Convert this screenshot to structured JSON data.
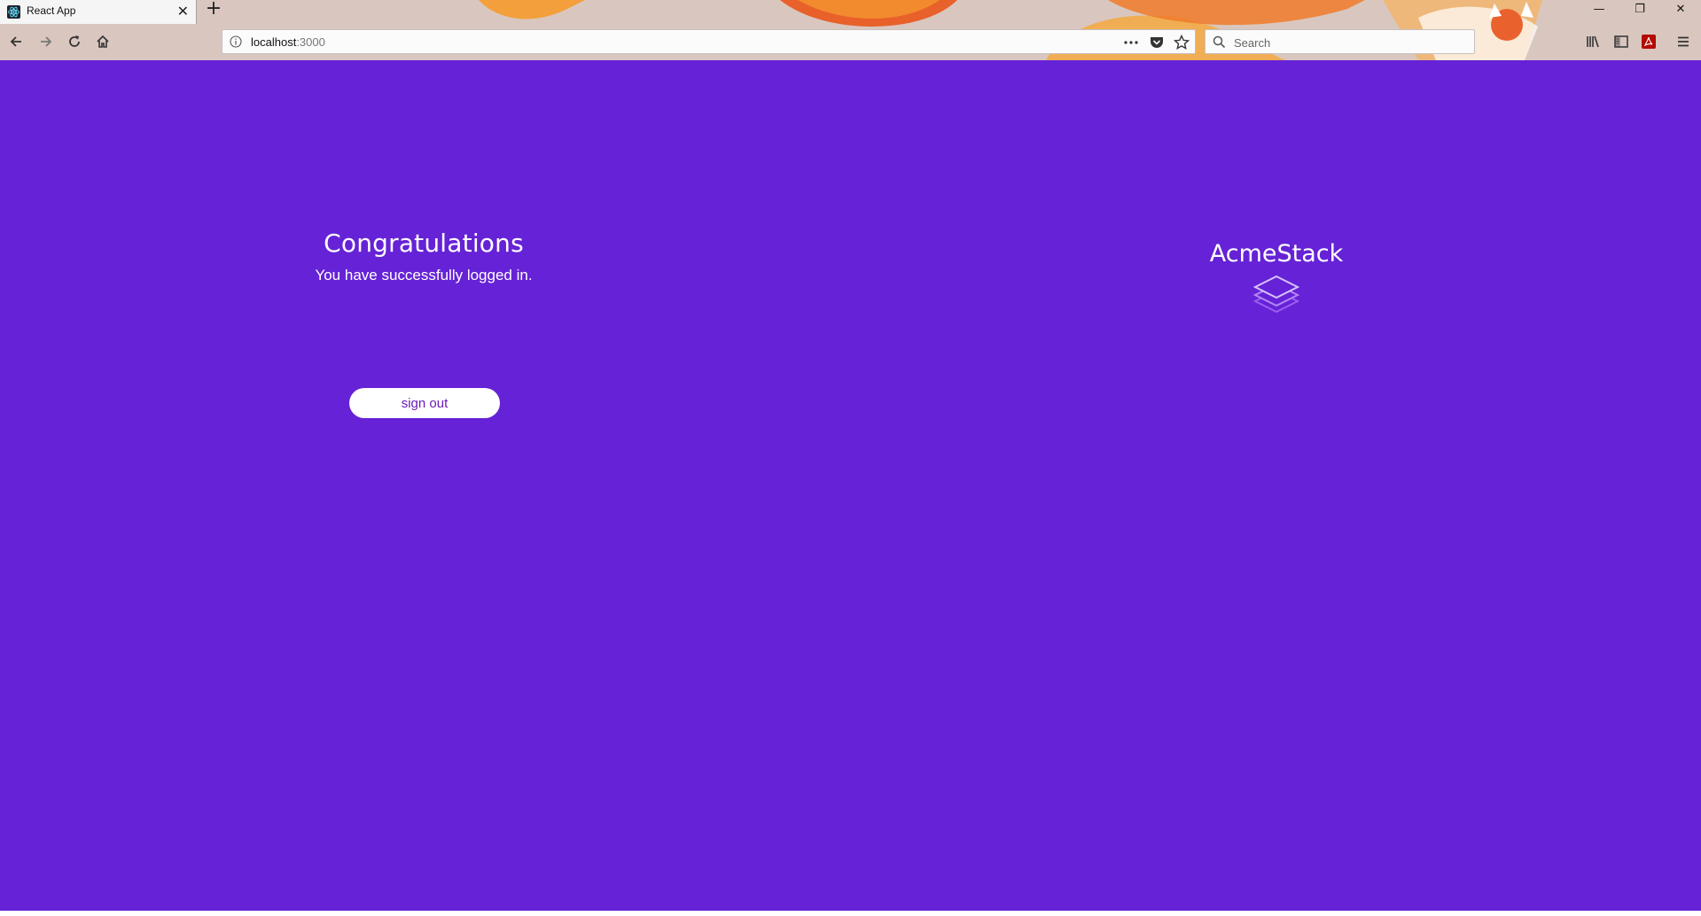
{
  "browser": {
    "tab": {
      "title": "React App"
    },
    "url": {
      "host": "localhost",
      "port": ":3000"
    },
    "search": {
      "placeholder": "Search"
    }
  },
  "page": {
    "heading": "Congratulations",
    "message": "You have successfully logged in.",
    "sign_out_label": "sign out",
    "brand": "AcmeStack"
  },
  "colors": {
    "background": "#6622d6",
    "button_text": "#6a1bb8"
  }
}
